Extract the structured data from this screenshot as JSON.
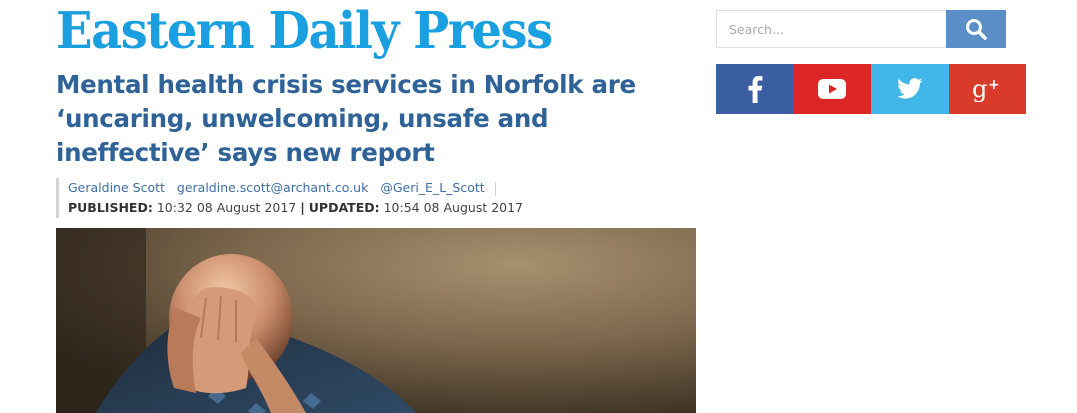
{
  "site": {
    "logo": "Eastern Daily Press",
    "brand_color": "#1aa0e0"
  },
  "article": {
    "headline": "Mental health crisis services in Norfolk are ‘uncaring, unwelcoming, unsafe and ineffective’ says new report",
    "author": "Geraldine Scott",
    "email": "geraldine.scott@archant.co.uk",
    "twitter": "@Geri_E_L_Scott",
    "published_label": "PUBLISHED:",
    "published_value": "10:32 08 August 2017",
    "separator": "|",
    "updated_label": "UPDATED:",
    "updated_value": "10:54 08 August 2017",
    "headline_color": "#2f6297"
  },
  "search": {
    "placeholder": "Search...",
    "button_icon": "search-icon",
    "button_color": "#5b8fc8"
  },
  "social": [
    {
      "icon": "facebook-icon",
      "color": "#3b5ea2"
    },
    {
      "icon": "youtube-icon",
      "color": "#dc2626"
    },
    {
      "icon": "twitter-icon",
      "color": "#40b7e8"
    },
    {
      "icon": "google-plus-icon",
      "color": "#d93b2b"
    }
  ]
}
